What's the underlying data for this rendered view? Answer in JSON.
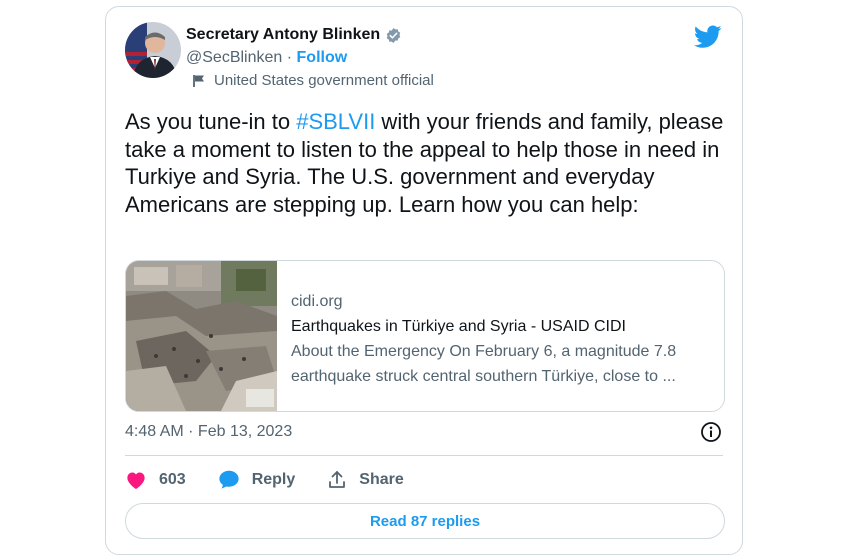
{
  "author": {
    "name": "Secretary Antony Blinken",
    "handle": "@SecBlinken",
    "separator": "·",
    "follow_label": "Follow",
    "label": "United States government official"
  },
  "tweet": {
    "text_before": "As you tune-in to ",
    "hashtag": "#SBLVII",
    "text_after": " with your friends and family, please take a moment to listen to the appeal to help those in need in Turkiye and Syria. The U.S. government and everyday Americans are stepping up. Learn how you can help:"
  },
  "link_card": {
    "domain": "cidi.org",
    "title": "Earthquakes in Türkiye and Syria - USAID CIDI",
    "description_line1": "About the Emergency On February 6, a magnitude 7.8",
    "description_line2": "earthquake struck central southern Türkiye, close to ..."
  },
  "timestamp": "4:48 AM · Feb 13, 2023",
  "actions": {
    "likes": "603",
    "reply_label": "Reply",
    "share_label": "Share"
  },
  "read_replies_label": "Read 87 replies",
  "colors": {
    "accent": "#1d9bf0",
    "like": "#f91880",
    "text": "#0f1419",
    "muted": "#536471",
    "border": "#cfd9de"
  }
}
